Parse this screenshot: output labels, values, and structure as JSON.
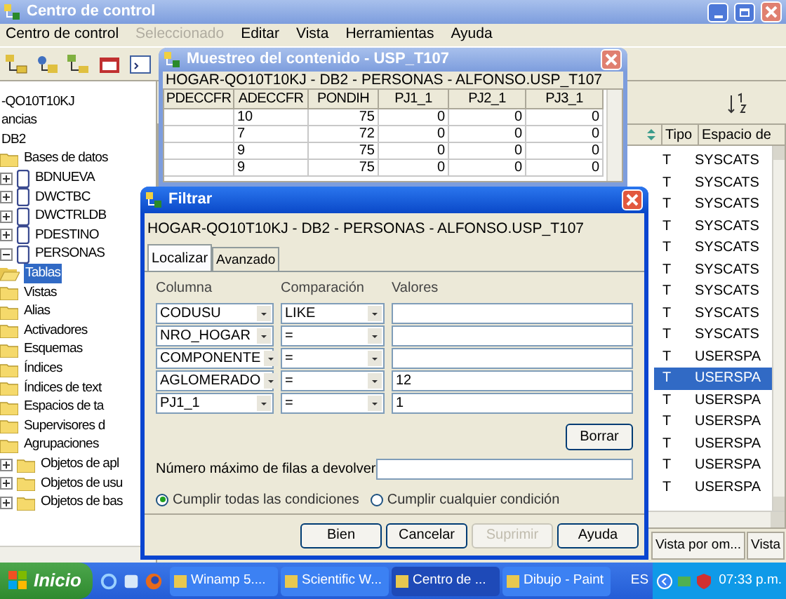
{
  "main_window": {
    "title": "Centro de control",
    "menu": [
      {
        "label": "Centro de control",
        "disabled": false
      },
      {
        "label": "Seleccionado",
        "disabled": true
      },
      {
        "label": "Editar",
        "disabled": false
      },
      {
        "label": "Vista",
        "disabled": false
      },
      {
        "label": "Herramientas",
        "disabled": false
      },
      {
        "label": "Ayuda",
        "disabled": false
      }
    ],
    "tree": [
      {
        "label": "-QO10T10KJ",
        "selected": false,
        "children": [
          {
            "label": "ancias",
            "selected": false
          },
          {
            "label": "DB2",
            "selected": false,
            "children": [
              {
                "label": "Bases de datos",
                "kind": "folder",
                "selected": false,
                "children": [
                  {
                    "label": "BDNUEVA",
                    "kind": "database",
                    "expanded": false,
                    "selected": false
                  },
                  {
                    "label": "DWCTBC",
                    "kind": "database",
                    "expanded": false,
                    "selected": false
                  },
                  {
                    "label": "DWCTRLDB",
                    "kind": "database",
                    "expanded": false,
                    "selected": false
                  },
                  {
                    "label": "PDESTINO",
                    "kind": "database",
                    "expanded": false,
                    "selected": false
                  },
                  {
                    "label": "PERSONAS",
                    "kind": "database",
                    "expanded": true,
                    "selected": false,
                    "children": [
                      {
                        "label": "Tablas",
                        "kind": "open-folder",
                        "selected": true
                      },
                      {
                        "label": "Vistas",
                        "kind": "folder",
                        "selected": false
                      },
                      {
                        "label": "Alias",
                        "kind": "folder",
                        "selected": false
                      },
                      {
                        "label": "Activadores",
                        "kind": "folder",
                        "selected": false
                      },
                      {
                        "label": "Esquemas",
                        "kind": "folder",
                        "selected": false
                      },
                      {
                        "label": "Índices",
                        "kind": "folder",
                        "selected": false
                      },
                      {
                        "label": "Índices de text",
                        "kind": "folder",
                        "selected": false
                      },
                      {
                        "label": "Espacios de ta",
                        "kind": "folder",
                        "selected": false
                      },
                      {
                        "label": "Supervisores d",
                        "kind": "folder",
                        "selected": false
                      },
                      {
                        "label": "Agrupaciones",
                        "kind": "folder",
                        "selected": false
                      },
                      {
                        "label": "Objetos de apl",
                        "kind": "folder",
                        "expanded": false,
                        "selected": false
                      },
                      {
                        "label": "Objetos de usu",
                        "kind": "folder",
                        "expanded": false,
                        "selected": false
                      },
                      {
                        "label": "Objetos de bas",
                        "kind": "folder",
                        "expanded": false,
                        "selected": false
                      }
                    ]
                  }
                ]
              }
            ]
          }
        ]
      }
    ],
    "table": {
      "columns": [
        "Tipo",
        "Espacio de"
      ],
      "rows": [
        {
          "tipo": "T",
          "espacio": "SYSCATS",
          "selected": false
        },
        {
          "tipo": "T",
          "espacio": "SYSCATS",
          "selected": false
        },
        {
          "tipo": "T",
          "espacio": "SYSCATS",
          "selected": false
        },
        {
          "tipo": "T",
          "espacio": "SYSCATS",
          "selected": false
        },
        {
          "tipo": "T",
          "espacio": "SYSCATS",
          "selected": false
        },
        {
          "tipo": "T",
          "espacio": "SYSCATS",
          "selected": false
        },
        {
          "tipo": "T",
          "espacio": "SYSCATS",
          "selected": false
        },
        {
          "tipo": "T",
          "espacio": "SYSCATS",
          "selected": false
        },
        {
          "tipo": "T",
          "espacio": "SYSCATS",
          "selected": false
        },
        {
          "tipo": "T",
          "espacio": "USERSPA",
          "selected": false
        },
        {
          "tipo": "T",
          "espacio": "USERSPA",
          "selected": true
        },
        {
          "tipo": "T",
          "espacio": "USERSPA",
          "selected": false
        },
        {
          "tipo": "T",
          "espacio": "USERSPA",
          "selected": false
        },
        {
          "tipo": "T",
          "espacio": "USERSPA",
          "selected": false
        },
        {
          "tipo": "T",
          "espacio": "USERSPA",
          "selected": false
        },
        {
          "tipo": "T",
          "espacio": "USERSPA",
          "selected": false
        }
      ]
    },
    "bottom_buttons": [
      "Vista por om...",
      "Vista"
    ]
  },
  "sample_window": {
    "title": "Muestreo del contenido - USP_T107",
    "path": "HOGAR-QO10T10KJ - DB2 - PERSONAS - ALFONSO.USP_T107",
    "columns": [
      "PDECCFR",
      "ADECCFR",
      "PONDIH",
      "PJ1_1",
      "PJ2_1",
      "PJ3_1"
    ],
    "rows": [
      [
        null,
        "10",
        "75",
        "0",
        "0",
        "0"
      ],
      [
        null,
        "7",
        "72",
        "0",
        "0",
        "0"
      ],
      [
        null,
        "9",
        "75",
        "0",
        "0",
        "0"
      ],
      [
        null,
        "9",
        "75",
        "0",
        "0",
        "0"
      ]
    ]
  },
  "filter_dialog": {
    "title": "Filtrar",
    "path": "HOGAR-QO10T10KJ - DB2 - PERSONAS - ALFONSO.USP_T107",
    "tabs": [
      {
        "label": "Localizar",
        "selected": true
      },
      {
        "label": "Avanzado",
        "selected": false
      }
    ],
    "headers": [
      "Columna",
      "Comparación",
      "Valores"
    ],
    "conditions": [
      {
        "column": "CODUSU",
        "comparison": "LIKE"
      },
      {
        "column": "NRO_HOGAR",
        "comparison": "="
      },
      {
        "column": "COMPONENTE",
        "comparison": "="
      },
      {
        "column": "AGLOMERADO",
        "comparison": "=",
        "value": "12"
      },
      {
        "column": "PJ1_1",
        "comparison": "=",
        "value": "1"
      }
    ],
    "clear_button": "Borrar",
    "max_rows": {
      "label": "Número máximo de filas a devolver"
    },
    "match_options": [
      {
        "label": "Cumplir todas las condiciones",
        "selected": true
      },
      {
        "label": "Cumplir cualquier condición",
        "selected": false
      }
    ],
    "buttons": [
      {
        "label": "Bien",
        "disabled": false
      },
      {
        "label": "Cancelar",
        "disabled": false
      },
      {
        "label": "Suprimir",
        "disabled": true
      },
      {
        "label": "Ayuda",
        "disabled": false
      }
    ]
  },
  "taskbar": {
    "start": "Inicio",
    "tasks": [
      {
        "label": "Winamp 5....",
        "selected": false
      },
      {
        "label": "Scientific W...",
        "selected": false
      },
      {
        "label": "Centro de ...",
        "selected": true
      },
      {
        "label": "Dibujo - Paint",
        "selected": false
      }
    ],
    "language": "ES",
    "clock": "07:33 p.m."
  }
}
